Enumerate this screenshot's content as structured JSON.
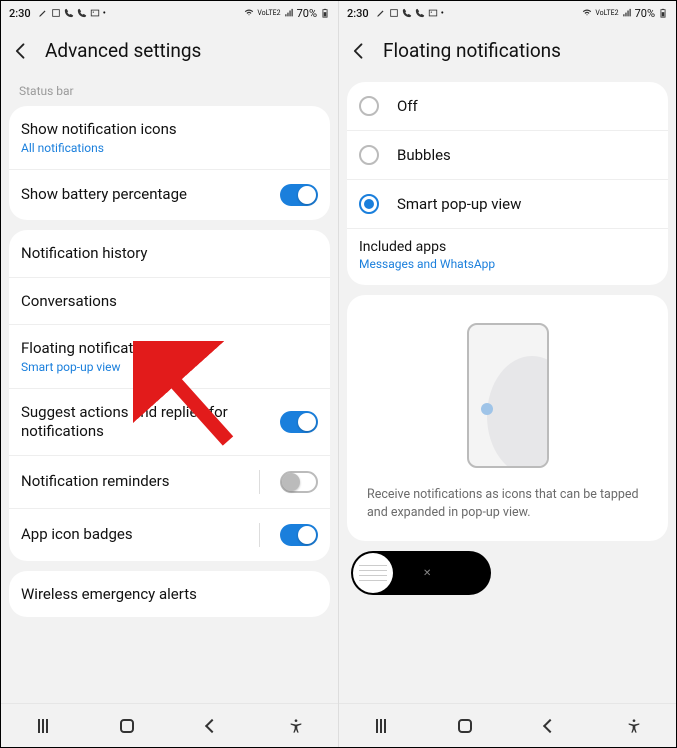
{
  "status": {
    "time": "2:30",
    "battery": "70%",
    "net_label": "VoLTE2"
  },
  "left": {
    "title": "Advanced settings",
    "section_statusbar": "Status bar",
    "show_notif_icons": {
      "title": "Show notification icons",
      "sub": "All notifications"
    },
    "show_battery_pct": {
      "title": "Show battery percentage",
      "on": true
    },
    "notif_history": "Notification history",
    "conversations": "Conversations",
    "floating": {
      "title": "Floating notifications",
      "sub": "Smart pop-up view"
    },
    "suggest": {
      "title": "Suggest actions and replies for notifications",
      "on": true
    },
    "reminders": {
      "title": "Notification reminders",
      "on": false
    },
    "badges": {
      "title": "App icon badges",
      "on": true
    },
    "wireless_alerts": "Wireless emergency alerts"
  },
  "right": {
    "title": "Floating notifications",
    "options": {
      "off": "Off",
      "bubbles": "Bubbles",
      "smart": "Smart pop-up view",
      "selected": "smart"
    },
    "included": {
      "title": "Included apps",
      "sub": "Messages and WhatsApp"
    },
    "preview_desc": "Receive notifications as icons that can be tapped and expanded in pop-up view."
  }
}
